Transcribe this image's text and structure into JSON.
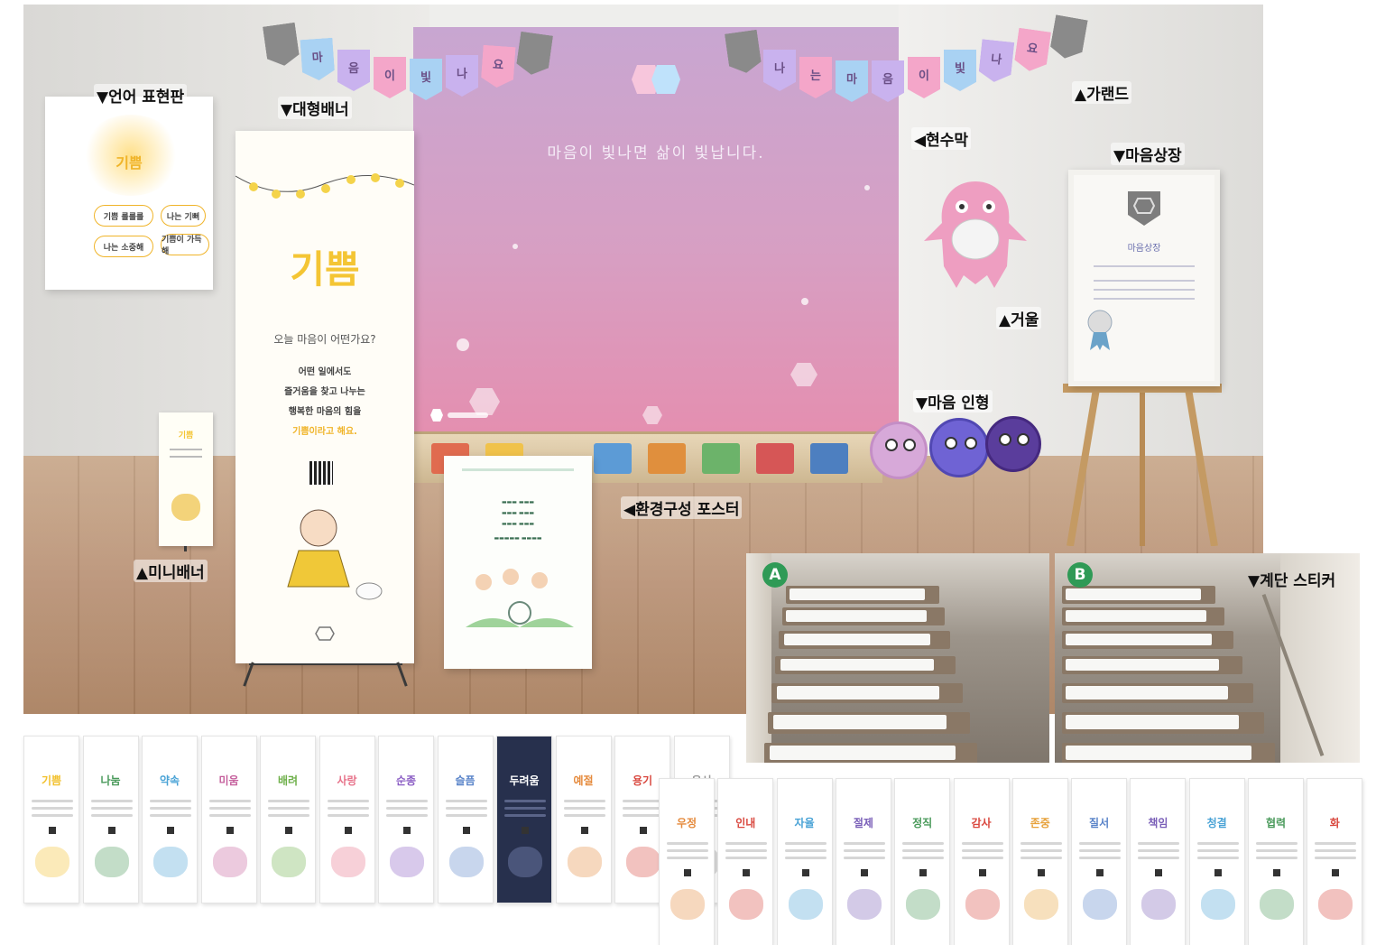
{
  "labels": {
    "language_board": "▼언어 표현판",
    "big_banner": "▼대형배너",
    "garland": "▲가랜드",
    "backdrop": "◀현수막",
    "award": "▼마음상장",
    "mirror": "▲거울",
    "doll": "▼마음 인형",
    "mini_banner": "▲미니배너",
    "env_poster": "◀환경구성 포스터",
    "stair_sticker": "▼계단 스티커"
  },
  "garland_left": [
    "마",
    "음",
    "이",
    "빛",
    "나",
    "요"
  ],
  "garland_right": [
    "나",
    "는",
    "마",
    "음",
    "이",
    "빛",
    "나",
    "요"
  ],
  "backdrop": {
    "slogan": "마음이 빛나면 삶이 빛납니다."
  },
  "big_banner": {
    "title": "기쁨",
    "question": "오늘 마음이 어떤가요?",
    "lines": [
      "어떤 일에서도",
      "즐거움을 찾고 나누는",
      "행복한 마음의 힘을",
      "기쁨이라고 해요."
    ]
  },
  "mini_banner": {
    "title": "기쁨"
  },
  "language_board": {
    "title": "기쁨",
    "pills": [
      "기쁨 룰룰룰",
      "나는 기뻐",
      "나는 소중해",
      "기쁨이 가득해"
    ]
  },
  "certificate": {
    "title": "마음상장"
  },
  "stair_badges": [
    "A",
    "B"
  ],
  "cards_top": [
    {
      "title": "기쁨",
      "color": "#f2c12e",
      "bg": "#ffffff"
    },
    {
      "title": "나눔",
      "color": "#4a9a5b",
      "bg": "#ffffff"
    },
    {
      "title": "약속",
      "color": "#4aa3d6",
      "bg": "#ffffff"
    },
    {
      "title": "미움",
      "color": "#c55f9c",
      "bg": "#ffffff"
    },
    {
      "title": "배려",
      "color": "#6fb04b",
      "bg": "#ffffff"
    },
    {
      "title": "사랑",
      "color": "#e7728a",
      "bg": "#ffffff"
    },
    {
      "title": "순종",
      "color": "#8a5cc4",
      "bg": "#ffffff"
    },
    {
      "title": "슬픔",
      "color": "#5a84c9",
      "bg": "#ffffff"
    },
    {
      "title": "두려움",
      "color": "#ffffff",
      "bg": "#27304d"
    },
    {
      "title": "예절",
      "color": "#e58a3c",
      "bg": "#ffffff"
    },
    {
      "title": "용기",
      "color": "#d9483f",
      "bg": "#ffffff"
    },
    {
      "title": "용서",
      "color": "#9a9a9a",
      "bg": "#ffffff"
    }
  ],
  "cards_bottom": [
    {
      "title": "우정",
      "color": "#e58a3c"
    },
    {
      "title": "인내",
      "color": "#d9483f"
    },
    {
      "title": "자율",
      "color": "#4aa3d6"
    },
    {
      "title": "절제",
      "color": "#7a5fb8"
    },
    {
      "title": "정직",
      "color": "#4a9a5b"
    },
    {
      "title": "감사",
      "color": "#d9483f"
    },
    {
      "title": "존중",
      "color": "#e7a13a"
    },
    {
      "title": "질서",
      "color": "#5a84c9"
    },
    {
      "title": "책임",
      "color": "#7a5fb8"
    },
    {
      "title": "청결",
      "color": "#4aa3d6"
    },
    {
      "title": "협력",
      "color": "#4a9a5b"
    },
    {
      "title": "화",
      "color": "#d9483f"
    }
  ]
}
